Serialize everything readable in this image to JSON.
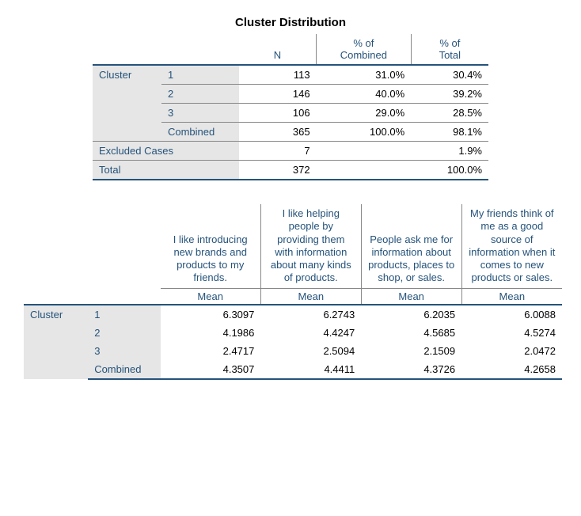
{
  "title": "Cluster Distribution",
  "table1": {
    "cols": {
      "n": "N",
      "pcomb": "% of\nCombined",
      "ptot": "% of\nTotal"
    },
    "stub_group": "Cluster",
    "rows": {
      "r1": {
        "label": "1",
        "n": "113",
        "pcomb": "31.0%",
        "ptot": "30.4%"
      },
      "r2": {
        "label": "2",
        "n": "146",
        "pcomb": "40.0%",
        "ptot": "39.2%"
      },
      "r3": {
        "label": "3",
        "n": "106",
        "pcomb": "29.0%",
        "ptot": "28.5%"
      },
      "rcomb": {
        "label": "Combined",
        "n": "365",
        "pcomb": "100.0%",
        "ptot": "98.1%"
      },
      "rex": {
        "label": "Excluded Cases",
        "n": "7",
        "pcomb": "",
        "ptot": "1.9%"
      },
      "rtot": {
        "label": "Total",
        "n": "372",
        "pcomb": "",
        "ptot": "100.0%"
      }
    }
  },
  "table2": {
    "vars": {
      "v1": "I like introducing new brands and products to my friends.",
      "v2": "I like helping people by providing them with information about many kinds of products.",
      "v3": "People ask me for information about products, places to shop, or sales.",
      "v4": "My friends think of me as a good source of information when it comes to new products or sales."
    },
    "stat_label": "Mean",
    "stub_group": "Cluster",
    "rows": {
      "r1": {
        "label": "1",
        "v1": "6.3097",
        "v2": "6.2743",
        "v3": "6.2035",
        "v4": "6.0088"
      },
      "r2": {
        "label": "2",
        "v1": "4.1986",
        "v2": "4.4247",
        "v3": "4.5685",
        "v4": "4.5274"
      },
      "r3": {
        "label": "3",
        "v1": "2.4717",
        "v2": "2.5094",
        "v3": "2.1509",
        "v4": "2.0472"
      },
      "rcomb": {
        "label": "Combined",
        "v1": "4.3507",
        "v2": "4.4411",
        "v3": "4.3726",
        "v4": "4.2658"
      }
    }
  },
  "chart_data": [
    {
      "type": "table",
      "title": "Cluster Distribution",
      "columns": [
        "Row",
        "N",
        "% of Combined",
        "% of Total"
      ],
      "rows": [
        [
          "Cluster 1",
          113,
          31.0,
          30.4
        ],
        [
          "Cluster 2",
          146,
          40.0,
          39.2
        ],
        [
          "Cluster 3",
          106,
          29.0,
          28.5
        ],
        [
          "Cluster Combined",
          365,
          100.0,
          98.1
        ],
        [
          "Excluded Cases",
          7,
          null,
          1.9
        ],
        [
          "Total",
          372,
          null,
          100.0
        ]
      ]
    },
    {
      "type": "table",
      "title": "Cluster Means",
      "columns": [
        "Row",
        "I like introducing new brands and products to my friends. (Mean)",
        "I like helping people by providing them with information about many kinds of products. (Mean)",
        "People ask me for information about products, places to shop, or sales. (Mean)",
        "My friends think of me as a good source of information when it comes to new products or sales. (Mean)"
      ],
      "rows": [
        [
          "Cluster 1",
          6.3097,
          6.2743,
          6.2035,
          6.0088
        ],
        [
          "Cluster 2",
          4.1986,
          4.4247,
          4.5685,
          4.5274
        ],
        [
          "Cluster 3",
          2.4717,
          2.5094,
          2.1509,
          2.0472
        ],
        [
          "Combined",
          4.3507,
          4.4411,
          4.3726,
          4.2658
        ]
      ]
    }
  ]
}
